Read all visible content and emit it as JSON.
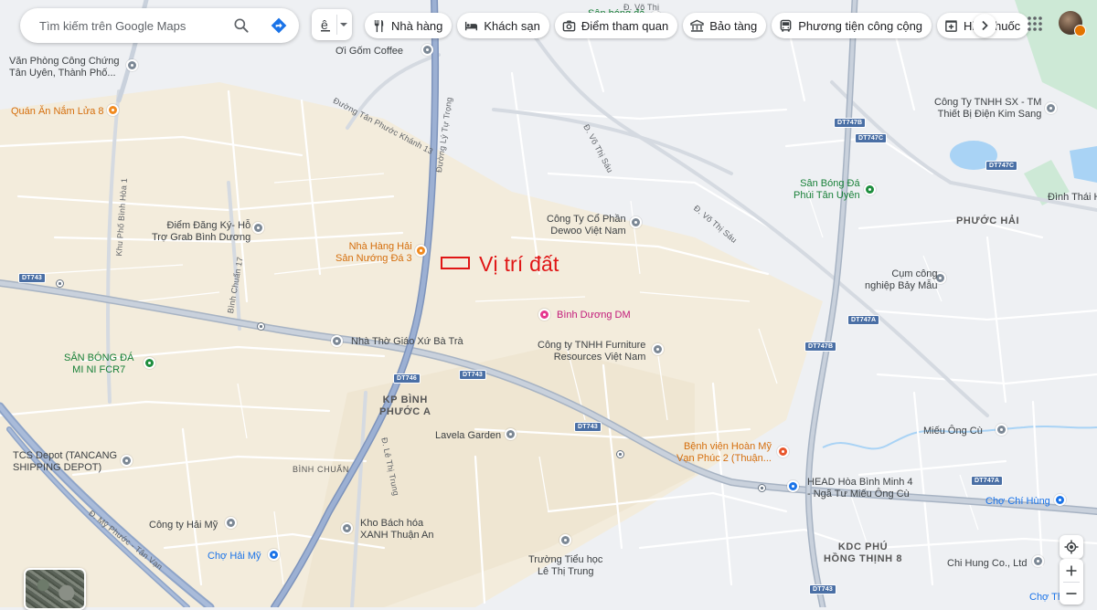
{
  "search": {
    "placeholder": "Tìm kiếm trên Google Maps"
  },
  "chips": [
    {
      "label": "Nhà hàng",
      "icon": "fork-knife-icon"
    },
    {
      "label": "Khách sạn",
      "icon": "bed-icon"
    },
    {
      "label": "Điểm tham quan",
      "icon": "camera-icon"
    },
    {
      "label": "Bảo tàng",
      "icon": "museum-icon"
    },
    {
      "label": "Phương tiện công cộng",
      "icon": "bus-icon"
    },
    {
      "label": "Hiệu thuốc",
      "icon": "pharmacy-icon"
    }
  ],
  "annotation": {
    "label": "Vị trí đất"
  },
  "places": [
    {
      "label": "Văn Phòng Công Chứng\nTân Uyên, Thành Phố...",
      "kind": "gray"
    },
    {
      "label": "Ơi Gốm Coffee",
      "kind": "gray"
    },
    {
      "label": "Sân bóng đá",
      "kind": "green"
    },
    {
      "label": "Quán Ăn Nắm Lửa 8",
      "kind": "orange"
    },
    {
      "label": "Công Ty TNHH SX - TM\nThiết Bị Điện Kim Sang",
      "kind": "gray"
    },
    {
      "label": "Sân Bóng Đá\nPhúi Tân Uyên",
      "kind": "green"
    },
    {
      "label": "Đình Thái H",
      "kind": "gray"
    },
    {
      "label": "Điểm Đăng Ký- Hỗ\nTrợ Grab Bình Dương",
      "kind": "gray"
    },
    {
      "label": "Công Ty Cổ Phần\nDewoo Việt Nam",
      "kind": "gray"
    },
    {
      "label": "Nhà Hàng Hải\nSản Nướng Đá 3",
      "kind": "orange"
    },
    {
      "label": "Cụm công\nnghiệp Bảy Mẫu",
      "kind": "gray"
    },
    {
      "label": "Bình Dương DM",
      "kind": "pink"
    },
    {
      "label": "Nhà Thờ Giáo Xứ Bà Trà",
      "kind": "gray"
    },
    {
      "label": "Công ty TNHH Furniture\nResources Việt Nam",
      "kind": "gray"
    },
    {
      "label": "SÂN BÓNG ĐÁ\nMI NI FCR7",
      "kind": "green"
    },
    {
      "label": "Miếu Ông Cù",
      "kind": "gray"
    },
    {
      "label": "Lavela Garden",
      "kind": "gray"
    },
    {
      "label": "Bệnh viện Hoàn Mỹ\nVạn Phúc 2 (Thuận...",
      "kind": "red"
    },
    {
      "label": "TCS Depot (TANCANG\nSHIPPING DEPOT)",
      "kind": "gray"
    },
    {
      "label": "HEAD Hòa Bình Minh 4\n- Ngã Tư Miếu Ông Cù",
      "kind": "blue"
    },
    {
      "label": "Chợ Chí Hùng",
      "kind": "blue"
    },
    {
      "label": "Công ty Hải Mỹ",
      "kind": "gray"
    },
    {
      "label": "Kho Bách hóa\nXANH Thuận An",
      "kind": "gray"
    },
    {
      "label": "Chợ Hải Mỹ",
      "kind": "blue"
    },
    {
      "label": "Trường Tiểu học\nLê Thị Trung",
      "kind": "gray"
    },
    {
      "label": "Chi Hung Co., Ltd",
      "kind": "gray"
    },
    {
      "label": "Chợ Th",
      "kind": "blue"
    }
  ],
  "areas": [
    "PHƯỚC HẢI",
    "KP BÌNH\nPHƯỚC A",
    "BÌNH CHUẨN",
    "KDC PHÚ\nHỒNG THỊNH 8"
  ],
  "streets": [
    "Đường Tân Phước Khánh 13",
    "Đường Lý Tự Trọng",
    "Đ. Võ Thị Sáu",
    "Đ. Võ Thị Sáu",
    "Khu Phố Bình Hòa 1",
    "Bình Chuẩn 17",
    "Đ. Lê Thị Trung",
    "Đ. Mỹ Phước - Tân Vạn",
    "Đ. Võ Thị"
  ],
  "shields": [
    "DT747B",
    "DT747C",
    "DT747C",
    "DT743",
    "DT746",
    "DT743",
    "DT743",
    "DT747A",
    "DT747B",
    "DT747A",
    "DT743"
  ],
  "colors": {
    "annotation": "#e01616",
    "road_major": "#8ea4c8",
    "road_minor": "#ffffff",
    "water": "#a9d3f5",
    "park": "#cde9d6"
  }
}
